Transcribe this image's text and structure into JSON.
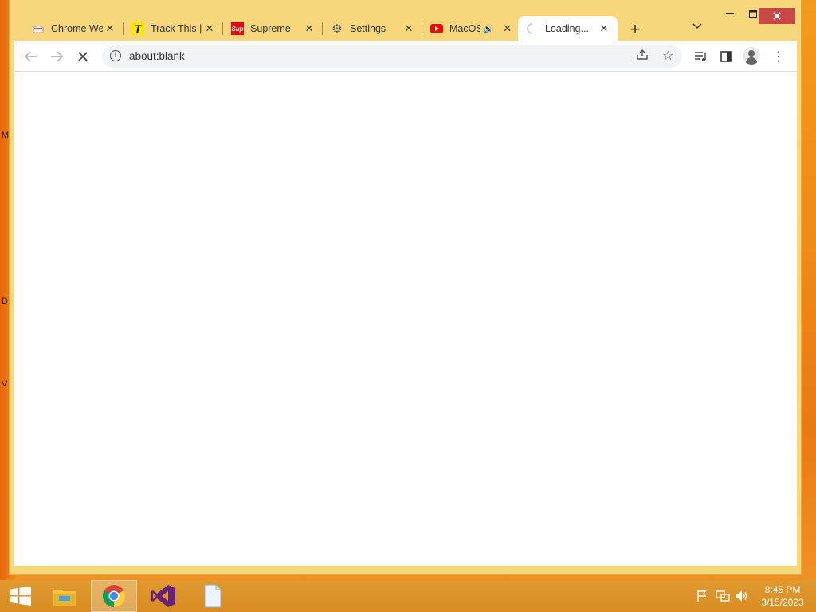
{
  "desktop": {
    "edge_letters": [
      "M",
      "D",
      "V"
    ]
  },
  "browser": {
    "tabs": [
      {
        "title": "Chrome We",
        "favicon": "chrome-store-icon",
        "active": false,
        "muted_icon": false
      },
      {
        "title": "Track This |",
        "favicon": "trackthis-icon",
        "active": false,
        "muted_icon": false
      },
      {
        "title": "Supreme",
        "favicon": "supreme-icon",
        "active": false,
        "muted_icon": false
      },
      {
        "title": "Settings",
        "favicon": "gear-icon",
        "active": false,
        "muted_icon": false
      },
      {
        "title": "MacOS",
        "favicon": "youtube-icon",
        "active": false,
        "muted_icon": true
      },
      {
        "title": "Loading...",
        "favicon": "loading-spinner-icon",
        "active": true,
        "muted_icon": false
      }
    ],
    "new_tab_label": "+",
    "address": "about:blank",
    "window_controls": {
      "minimize": "—",
      "maximize": "☐",
      "close": "✕"
    }
  },
  "taskbar": {
    "apps": [
      "windows-start",
      "file-explorer",
      "chrome",
      "visual-studio",
      "notepad"
    ],
    "clock": {
      "time": "8:45 PM",
      "date": "3/15/2023"
    }
  },
  "colors": {
    "window_frame": "#f8d77c",
    "close_button": "#c94a45",
    "taskbar": "#d88c22"
  }
}
